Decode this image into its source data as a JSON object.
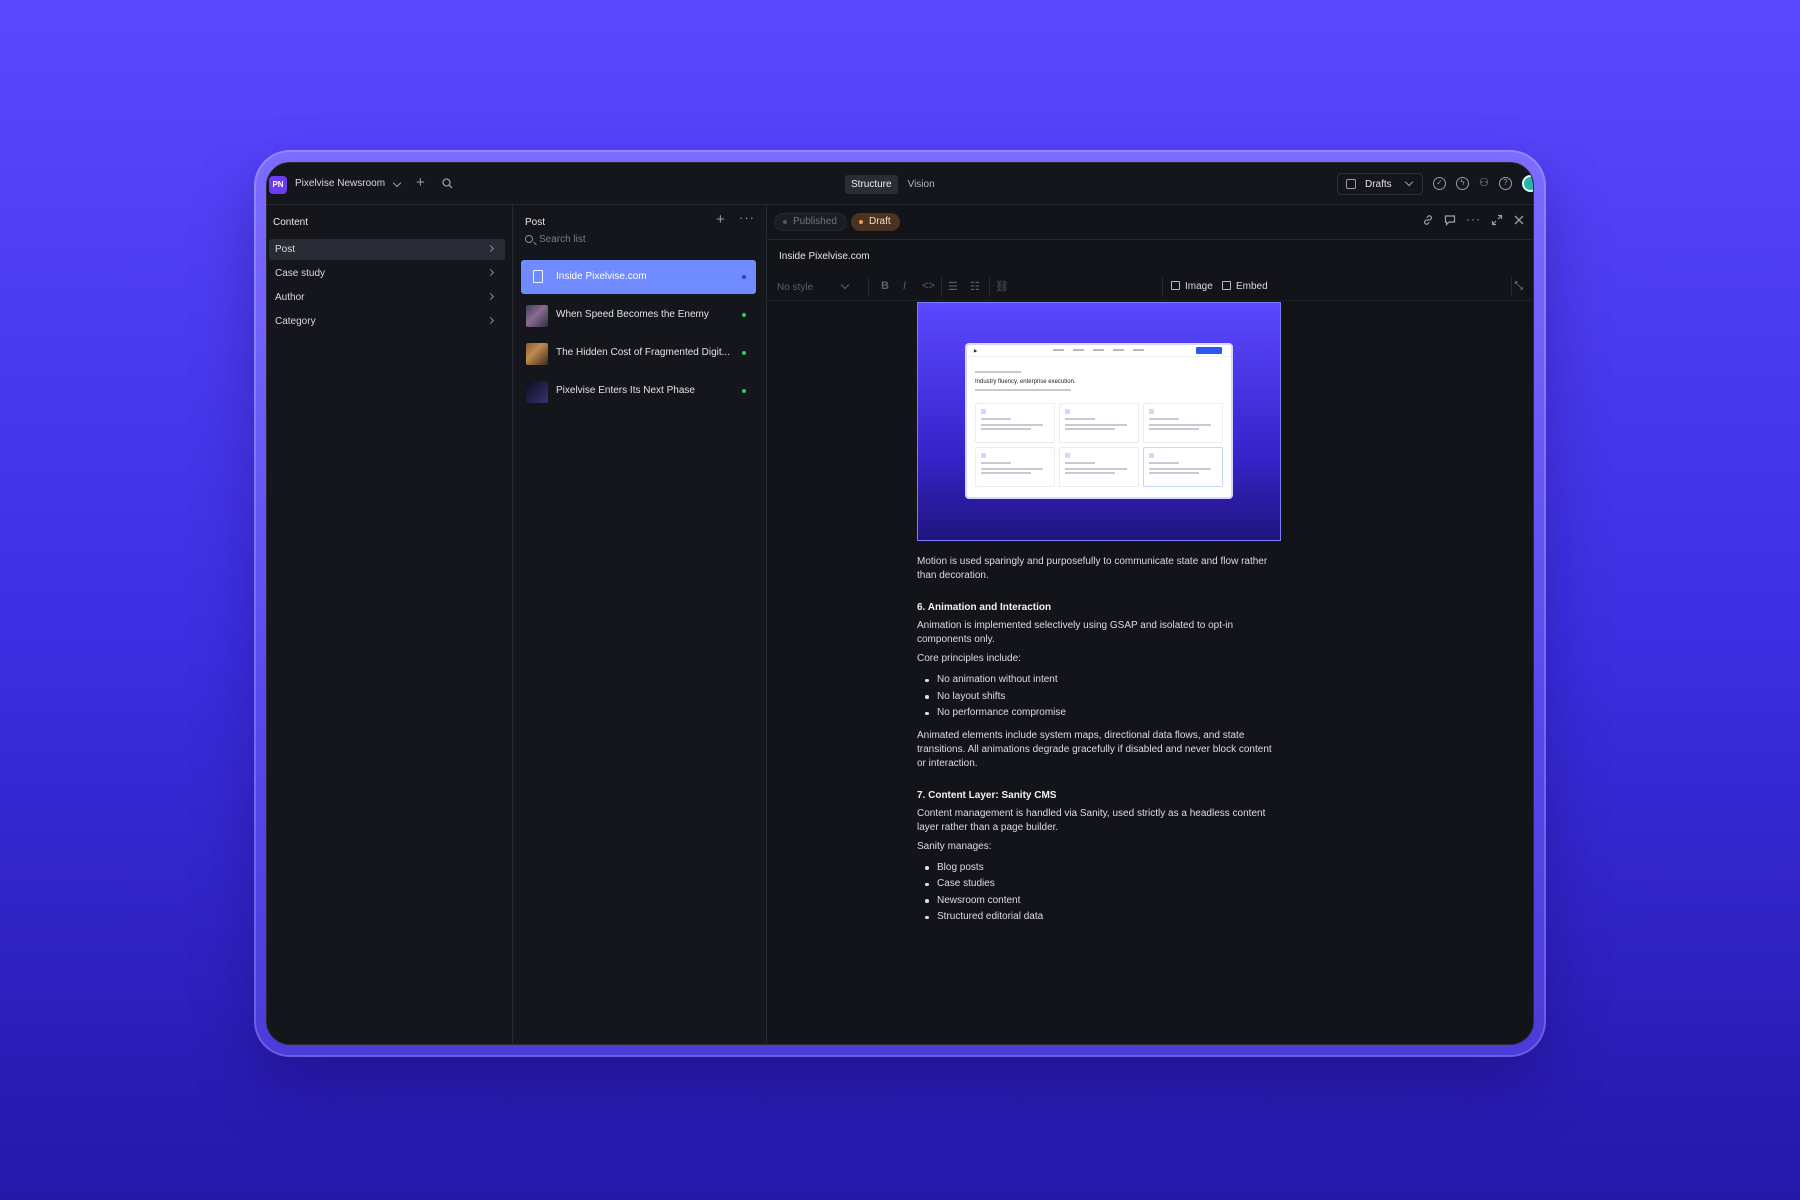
{
  "workspace": {
    "initials": "PN",
    "name": "Pixelvise Newsroom"
  },
  "modes": {
    "structure": "Structure",
    "vision": "Vision"
  },
  "perspective": {
    "label": "Drafts"
  },
  "content_pane": {
    "title": "Content",
    "items": [
      {
        "label": "Post"
      },
      {
        "label": "Case study"
      },
      {
        "label": "Author"
      },
      {
        "label": "Category"
      }
    ]
  },
  "post_pane": {
    "title": "Post",
    "search_placeholder": "Search list",
    "items": [
      {
        "title": "Inside Pixelvise.com"
      },
      {
        "title": "When Speed Becomes the Enemy"
      },
      {
        "title": "The Hidden Cost of Fragmented Digit..."
      },
      {
        "title": "Pixelvise Enters Its Next Phase"
      }
    ]
  },
  "document": {
    "status_published": "Published",
    "status_draft": "Draft",
    "title": "Inside Pixelvise.com",
    "toolbar": {
      "style": "No style",
      "bold": "B",
      "italic": "I",
      "image": "Image",
      "embed": "Embed"
    },
    "hero_preview": {
      "headline": "Industry fluency, enterprise execution."
    },
    "body": {
      "p1": "Motion is used sparingly and purposefully to communicate state and flow rather than decoration.",
      "h6": "6. Animation and Interaction",
      "p2": "Animation is implemented selectively using GSAP and isolated to opt-in components only.",
      "p3": "Core principles include:",
      "list1": [
        "No animation without intent",
        "No layout shifts",
        "No performance compromise"
      ],
      "p4": "Animated elements include system maps, directional data flows, and state transitions. All animations degrade gracefully if disabled and never block content or interaction.",
      "h7": "7. Content Layer: Sanity CMS",
      "p5": "Content management is handled via Sanity, used strictly as a headless content layer rather than a page builder.",
      "p6": "Sanity manages:",
      "list2": [
        "Blog posts",
        "Case studies",
        "Newsroom content",
        "Structured editorial data"
      ]
    }
  }
}
